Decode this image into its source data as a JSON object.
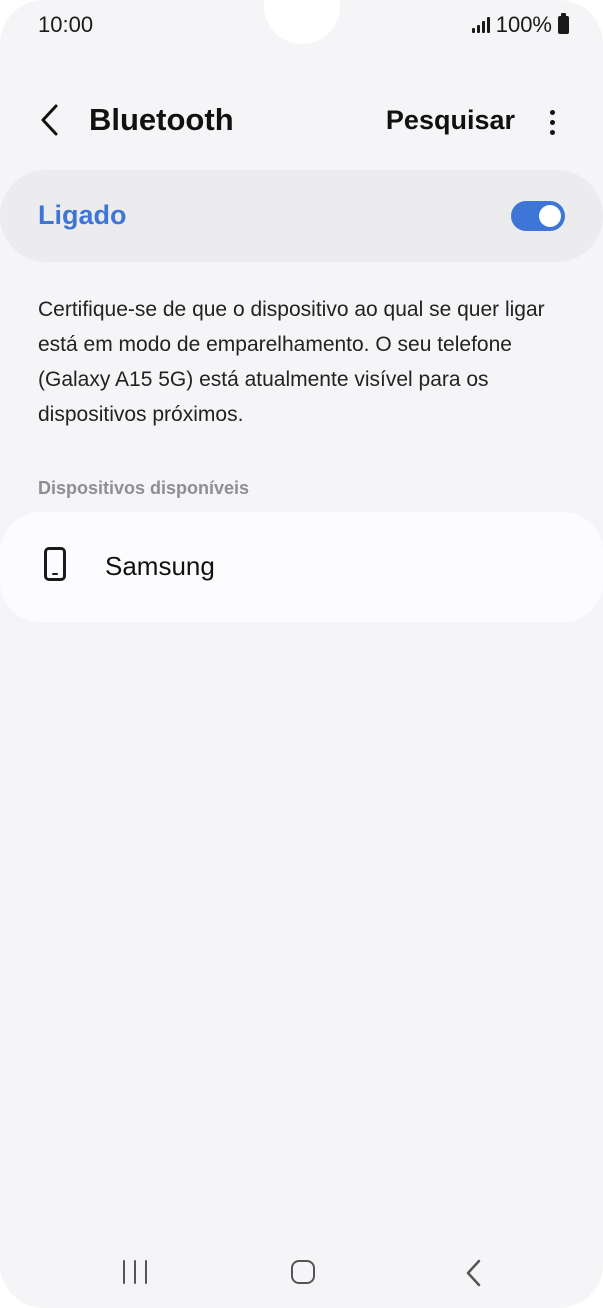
{
  "status_bar": {
    "time": "10:00",
    "battery": "100%"
  },
  "header": {
    "title": "Bluetooth",
    "search_label": "Pesquisar"
  },
  "toggle": {
    "label": "Ligado",
    "state": "on",
    "accent_color": "#3e76d8"
  },
  "info_text": "Certifique-se de que o dispositivo ao qual se quer ligar está em modo de emparelhamento. O seu telefone (Galaxy A15 5G) está atualmente visível para os dispositivos próximos.",
  "available_devices": {
    "section_title": "Dispositivos disponíveis",
    "items": [
      {
        "name": "Samsung",
        "icon": "smartphone-icon"
      }
    ]
  }
}
